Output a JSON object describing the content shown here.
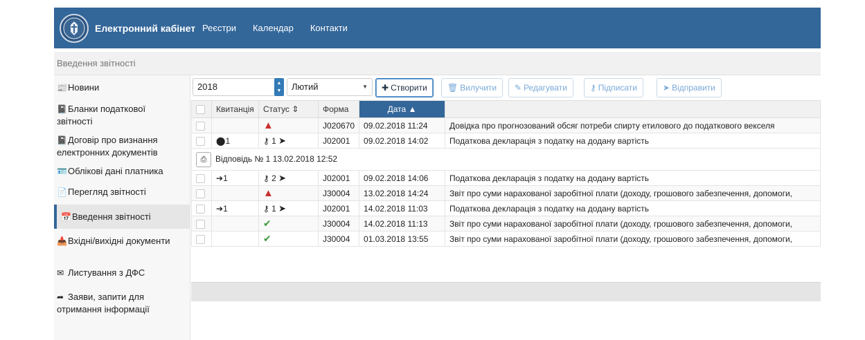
{
  "navbar": {
    "brand": "Електронний кабінет",
    "links": [
      "Реєстри",
      "Календар",
      "Контакти"
    ],
    "logo_icon": "state-emblem-icon",
    "bg_color": "#336699"
  },
  "breadcrumb": "Введення звітності",
  "sidebar": {
    "items": [
      {
        "label": "Новини",
        "icon": "newspaper-icon",
        "glyph": "📰"
      },
      {
        "label": "Бланки податкової звітності",
        "icon": "book-icon",
        "glyph": "📓"
      },
      {
        "label": "Договір про визнання електронних документів",
        "icon": "book-icon",
        "glyph": "📓"
      },
      {
        "label": "Облікові дані платника",
        "icon": "id-card-icon",
        "glyph": "🪪"
      },
      {
        "label": "Перегляд звітності",
        "icon": "file-text-icon",
        "glyph": "📄"
      },
      {
        "label": "Введення звітності",
        "icon": "calendar-icon",
        "glyph": "📅",
        "active": true
      },
      {
        "label": "Вхідні/вихідні документи",
        "icon": "inbox-icon",
        "glyph": "📥"
      },
      {
        "label": "Листування з ДФС",
        "icon": "envelope-icon",
        "glyph": "✉"
      },
      {
        "label": "Заяви, запити для отримання інформації",
        "icon": "share-arrow-icon",
        "glyph": "➦"
      }
    ]
  },
  "toolbar": {
    "year": "2018",
    "month": "Лютий",
    "create": "Створити",
    "delete": "Вилучити",
    "edit": "Редагувати",
    "sign": "Підписати",
    "send": "Відправити"
  },
  "table": {
    "headers": [
      "Квитанція",
      "Статус",
      "Форма",
      "Дата"
    ],
    "rows": [
      {
        "receipt": "",
        "status": "warning",
        "form": "J020670",
        "date": "09.02.2018 11:24",
        "desc": "Довідка про прогнозований обсяг потреби спирту етилового до податкового векселя"
      },
      {
        "receipt": "1",
        "status": "signed",
        "keys": "1",
        "form": "J02001",
        "date": "09.02.2018 14:02",
        "desc": "Податкова декларація з податку на додану вартість"
      },
      {
        "receipt": "1",
        "status": "signed",
        "keys": "2",
        "form": "J02001",
        "date": "09.02.2018 14:06",
        "desc": "Податкова декларація з податку на додану вартість"
      },
      {
        "receipt": "",
        "status": "warning",
        "form": "J30004",
        "date": "13.02.2018 14:24",
        "desc": "Звіт про суми нарахованої заробітної плати (доходу, грошового забезпечення, допомоги,"
      },
      {
        "receipt": "1",
        "status": "signed",
        "keys": "1",
        "form": "J02001",
        "date": "14.02.2018 11:03",
        "desc": "Податкова декларація з податку на додану вартість"
      },
      {
        "receipt": "",
        "status": "ok",
        "form": "J30004",
        "date": "14.02.2018 11:13",
        "desc": "Звіт про суми нарахованої заробітної плати (доходу, грошового забезпечення, допомоги,"
      },
      {
        "receipt": "",
        "status": "ok",
        "form": "J30004",
        "date": "01.03.2018 13:55",
        "desc": "Звіт про суми нарахованої заробітної плати (доходу, грошового забезпечення, допомоги,"
      }
    ],
    "subrow": "Відповідь № 1 13.02.2018 12:52"
  }
}
